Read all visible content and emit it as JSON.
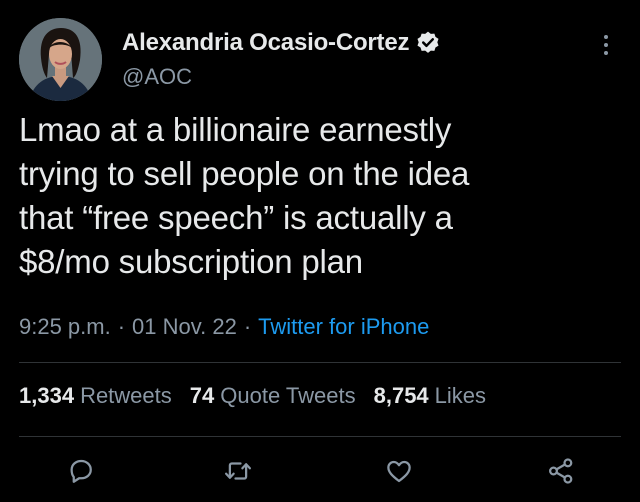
{
  "author": {
    "display_name": "Alexandria Ocasio-Cortez",
    "handle": "@AOC",
    "verified": true
  },
  "tweet": {
    "text_lines": [
      "Lmao at a billionaire earnestly",
      "trying to sell people on the idea",
      "that “free speech” is actually a",
      "$8/mo subscription plan"
    ],
    "time": "9:25 p.m.",
    "date": "01 Nov. 22",
    "separator": "·",
    "source": "Twitter for iPhone"
  },
  "stats": {
    "retweets": {
      "count": "1,334",
      "label": "Retweets"
    },
    "quote_tweets": {
      "count": "74",
      "label": "Quote Tweets"
    },
    "likes": {
      "count": "8,754",
      "label": "Likes"
    }
  },
  "colors": {
    "background": "#000000",
    "primary_text": "#e7e9ea",
    "secondary_text": "#8b98a5",
    "link": "#1d9bf0",
    "divider": "#2f3336"
  },
  "icons": {
    "verified": "verified-badge-icon",
    "more": "more-vertical-icon",
    "reply": "reply-icon",
    "retweet": "retweet-icon",
    "like": "heart-icon",
    "share": "share-icon"
  }
}
